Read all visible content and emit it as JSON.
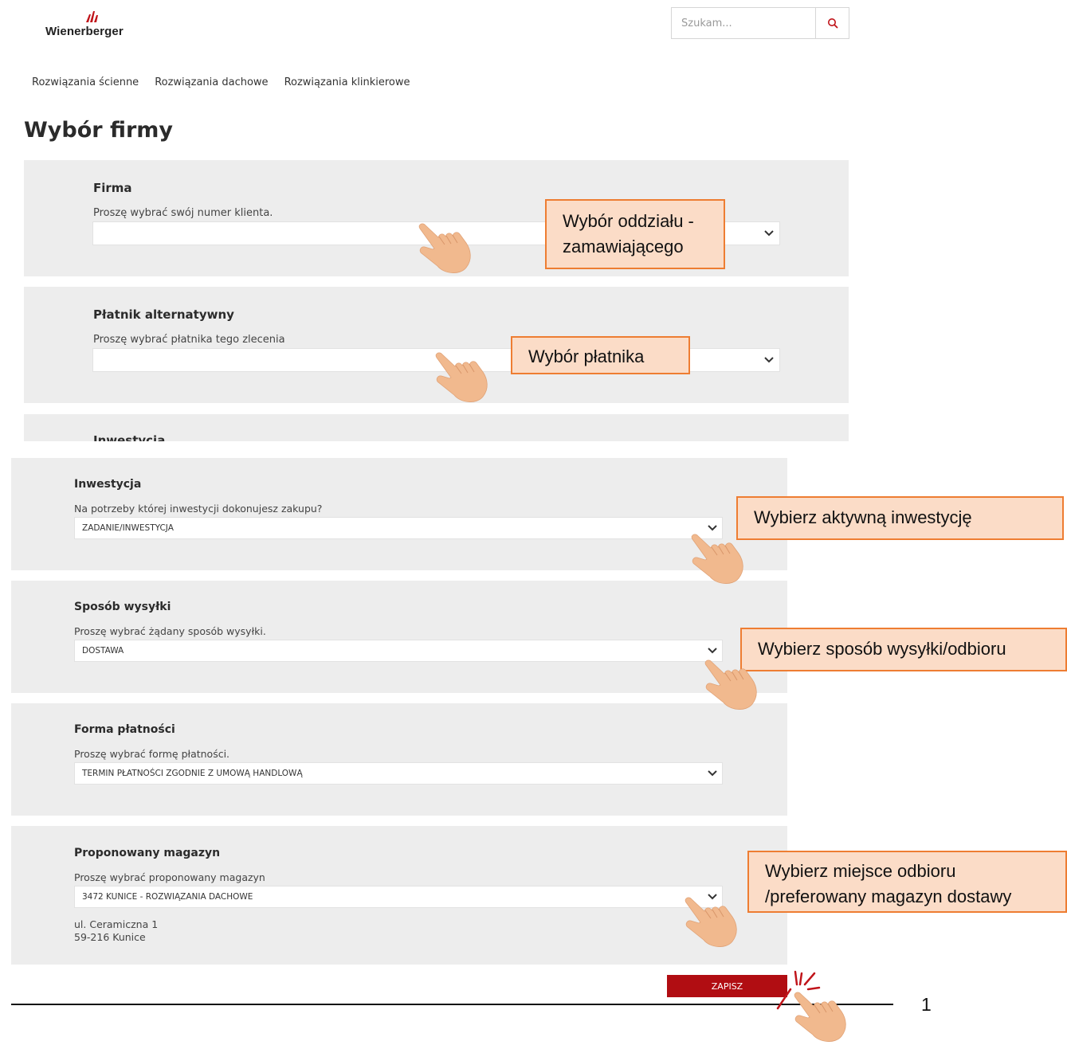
{
  "header": {
    "logo_text": "Wienerberger",
    "search": {
      "placeholder": "Szukam..."
    }
  },
  "nav": {
    "items": [
      "Rozwiązania ścienne",
      "Rozwiązania dachowe",
      "Rozwiązania klinkierowe"
    ]
  },
  "page_title": "Wybór firmy",
  "panels_top": {
    "firma": {
      "title": "Firma",
      "subtitle": "Proszę wybrać swój numer klienta.",
      "value": ""
    },
    "platnik": {
      "title": "Płatnik alternatywny",
      "subtitle": "Proszę wybrać płatnika tego zlecenia",
      "value": ""
    },
    "inwestycja_cut": {
      "title": "Inwestycja"
    }
  },
  "panels_bottom": {
    "inwestycja": {
      "title": "Inwestycja",
      "subtitle": "Na potrzeby której inwestycji dokonujesz zakupu?",
      "value": "ZADANIE/INWESTYCJA"
    },
    "wysylka": {
      "title": "Sposób wysyłki",
      "subtitle": "Proszę wybrać żądany sposób wysyłki.",
      "value": "DOSTAWA"
    },
    "platnosc": {
      "title": "Forma płatności",
      "subtitle": "Proszę wybrać formę płatności.",
      "value": "TERMIN PŁATNOŚCI ZGODNIE Z UMOWĄ HANDLOWĄ"
    },
    "magazyn": {
      "title": "Proponowany magazyn",
      "subtitle": "Proszę wybrać proponowany magazyn",
      "value": "3472 KUNICE - ROZWIĄZANIA DACHOWE",
      "address_line1": "ul. Ceramiczna 1",
      "address_line2": "59-216 Kunice"
    }
  },
  "save_label": "ZAPISZ",
  "page_number": "1",
  "callouts": {
    "oddzial_line1": "Wybór oddziału -",
    "oddzial_line2": "zamawiającego",
    "platnik": "Wybór płatnika",
    "inwestycja": "Wybierz aktywną inwestycję",
    "wysylka": "Wybierz sposób wysyłki/odbioru",
    "magazyn_line1": "Wybierz miejsce odbioru",
    "magazyn_line2": "/preferowany magazyn dostawy"
  },
  "colors": {
    "accent_red": "#b10d12",
    "panel_bg": "#ededed",
    "callout_fill": "#fbdcc7",
    "callout_border": "#ee7d32",
    "hand_skin": "#f1b98e"
  },
  "icons": {
    "search": "search-icon",
    "dropdown": "chevron-down-icon",
    "pointer": "pointing-hand-icon",
    "click": "click-burst-icon"
  }
}
